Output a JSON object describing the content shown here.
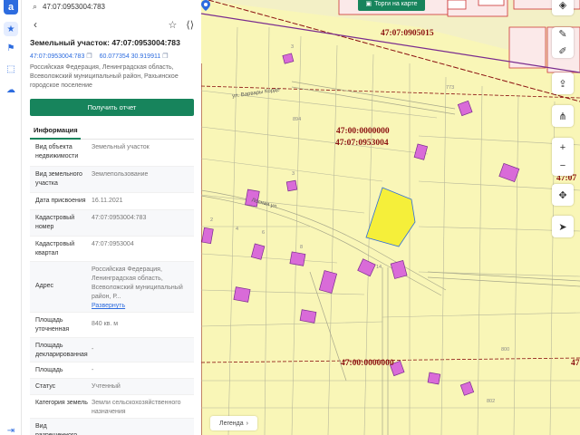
{
  "rail": {
    "logo": "a",
    "icons": [
      "star-icon",
      "flag-icon",
      "select-area-icon",
      "cloud-icon",
      "logout-icon"
    ]
  },
  "search": {
    "value": "47:07:0953004:783"
  },
  "card": {
    "title": "Земельный участок: 47:07:0953004:783",
    "cadastral_number": "47:07:0953004:783",
    "coords": "60.077354 30.919911",
    "address": "Российская Федерация, Ленинградская область, Всеволожский муниципальный район, Рахьинское городское поселение",
    "report_button": "Получить отчет",
    "tab_info": "Информация"
  },
  "info_rows": [
    {
      "key": "Вид объекта недвижимости",
      "value": "Земельный участок"
    },
    {
      "key": "Вид земельного участка",
      "value": "Землепользование"
    },
    {
      "key": "Дата присвоения",
      "value": "16.11.2021"
    },
    {
      "key": "Кадастровый номер",
      "value": "47:07:0953004:783"
    },
    {
      "key": "Кадастровый квартал",
      "value": "47:07:0953004"
    },
    {
      "key": "Адрес",
      "value": "Российская Федерация, Ленинградская область, Всеволожский муниципальный район, Р...",
      "link": "Развернуть"
    },
    {
      "key": "Площадь уточненная",
      "value": "840 кв. м"
    },
    {
      "key": "Площадь декларированная",
      "value": "-"
    },
    {
      "key": "Площадь",
      "value": "-"
    },
    {
      "key": "Статус",
      "value": "Учтенный"
    },
    {
      "key": "Категория земель",
      "value": "Земли сельскохозяйственного назначения"
    },
    {
      "key": "Вид разрешенного",
      "value": ""
    }
  ],
  "map": {
    "torgi_button": "Торги на карте",
    "legend_button": "Легенда",
    "labels": {
      "l1": "47:07:0905015",
      "l2": "47:00:0000000",
      "l3": "47:07:0953004",
      "l4": "47:00:0000000",
      "l5": "47:07",
      "l6": "47"
    },
    "street1": "ул. Варвары Корде",
    "street2": "Лесная ул.",
    "numbers": {
      "n1": "3",
      "n2": "773",
      "n3": "894",
      "n4": "3",
      "n5": "800",
      "n6": "802",
      "n7": "2",
      "n8": "4",
      "n9": "6",
      "n10": "8",
      "n11": "14"
    },
    "controls": [
      "layers-icon",
      "pen-icon",
      "edit-icon",
      "upload-icon",
      "share-icon",
      "zoom-in-icon",
      "zoom-out-icon",
      "move-icon",
      "locate-icon"
    ],
    "colors": {
      "land": "#f9f6b7",
      "selected": "#f5ef3a",
      "building": "#d96bd8",
      "boundary": "#8b1010",
      "purple_line": "#7a2c8e"
    }
  }
}
